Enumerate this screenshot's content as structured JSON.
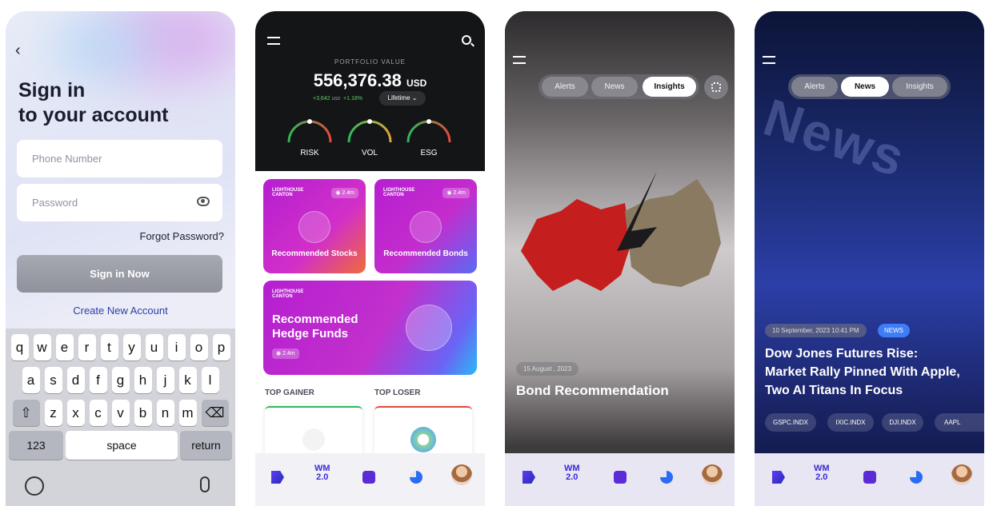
{
  "signin": {
    "back": "‹",
    "title_line1": "Sign in",
    "title_line2": "to your account",
    "phone_placeholder": "Phone Number",
    "password_placeholder": "Password",
    "forgot": "Forgot Password?",
    "signin_button": "Sign in Now",
    "create": "Create New Account"
  },
  "keyboard": {
    "row1": [
      "q",
      "w",
      "e",
      "r",
      "t",
      "y",
      "u",
      "i",
      "o",
      "p"
    ],
    "row2": [
      "a",
      "s",
      "d",
      "f",
      "g",
      "h",
      "j",
      "k",
      "l"
    ],
    "row3": [
      "z",
      "x",
      "c",
      "v",
      "b",
      "n",
      "m"
    ],
    "shift": "⇧",
    "backspace": "⌫",
    "num": "123",
    "space": "space",
    "return": "return"
  },
  "portfolio": {
    "label": "PORTFOLIO VALUE",
    "value": "556,376.38",
    "currency": "USD",
    "change_abs": "+3,642",
    "change_unit": "USD",
    "change_pct": "+1.18%",
    "period": "Lifetime",
    "gauges": [
      "RISK",
      "VOL",
      "ESG"
    ],
    "brand_line1": "LIGHTHOUSE",
    "brand_line2": "CANTON",
    "views": "2.4m",
    "card1": "Recommended Stocks",
    "card2": "Recommended Bonds",
    "card3_line1": "Recommended",
    "card3_line2": "Hedge Funds",
    "top_gainer": "TOP GAINER",
    "top_loser": "TOP LOSER"
  },
  "nav": {
    "wm_line1": "WM",
    "wm_line2": "2.0"
  },
  "insights": {
    "tabs": [
      "Alerts",
      "News",
      "Insights"
    ],
    "date": "15 August , 2023",
    "title": "Bond Recommendation"
  },
  "news": {
    "tabs": [
      "Alerts",
      "News",
      "Insights"
    ],
    "date": "10 September, 2023 10:41 PM",
    "badge": "NEWS",
    "title_line1": "Dow Jones Futures Rise:",
    "title_line2": "Market Rally Pinned With Apple,",
    "title_line3": "Two AI Titans In Focus",
    "indices": [
      "GSPC.INDX",
      "IXIC.INDX",
      "DJI.INDX",
      "AAPL"
    ],
    "bg_word": "News"
  },
  "colors": {
    "accent": "#3b2bd6",
    "gain": "#5ed16c",
    "badge": "#3d7df7"
  }
}
